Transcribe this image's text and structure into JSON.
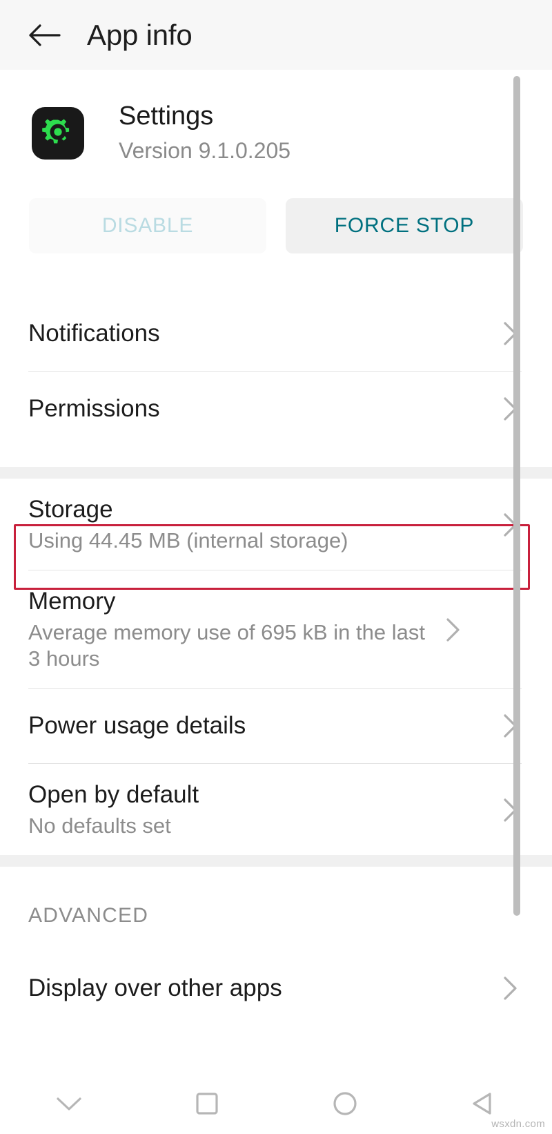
{
  "header": {
    "back_icon": "arrow-left-icon",
    "title": "App info"
  },
  "app": {
    "icon": "settings-gear-icon",
    "icon_bg": "#191919",
    "icon_fg": "#2ddd4e",
    "name": "Settings",
    "version": "Version 9.1.0.205"
  },
  "actions": {
    "disable_label": "DISABLE",
    "disable_enabled": false,
    "force_stop_label": "FORCE STOP",
    "force_stop_enabled": true,
    "accent_color": "#00707f",
    "disabled_color": "#b9dbe2"
  },
  "group1": [
    {
      "title": "Notifications",
      "sub": "",
      "chevron": "chevron-right-icon"
    },
    {
      "title": "Permissions",
      "sub": "",
      "chevron": "chevron-right-icon"
    }
  ],
  "group2": [
    {
      "title": "Storage",
      "sub": "Using 44.45 MB (internal storage)",
      "chevron": "chevron-right-icon",
      "highlighted": true
    },
    {
      "title": "Memory",
      "sub": "Average memory use of 695 kB in the last 3 hours",
      "chevron": "chevron-right-icon",
      "highlighted": false
    },
    {
      "title": "Power usage details",
      "sub": "",
      "chevron": "chevron-right-icon",
      "highlighted": false
    },
    {
      "title": "Open by default",
      "sub": "No defaults set",
      "chevron": "chevron-right-icon",
      "highlighted": false
    }
  ],
  "advanced": {
    "heading": "ADVANCED",
    "items": [
      {
        "title": "Display over other apps",
        "sub": "",
        "chevron": "chevron-right-icon"
      }
    ]
  },
  "highlight": {
    "color": "#c8203c"
  },
  "navbar": {
    "items": [
      {
        "icon": "chevron-down-icon"
      },
      {
        "icon": "square-icon"
      },
      {
        "icon": "circle-icon"
      },
      {
        "icon": "triangle-left-icon"
      }
    ]
  },
  "watermark": "wsxdn.com"
}
